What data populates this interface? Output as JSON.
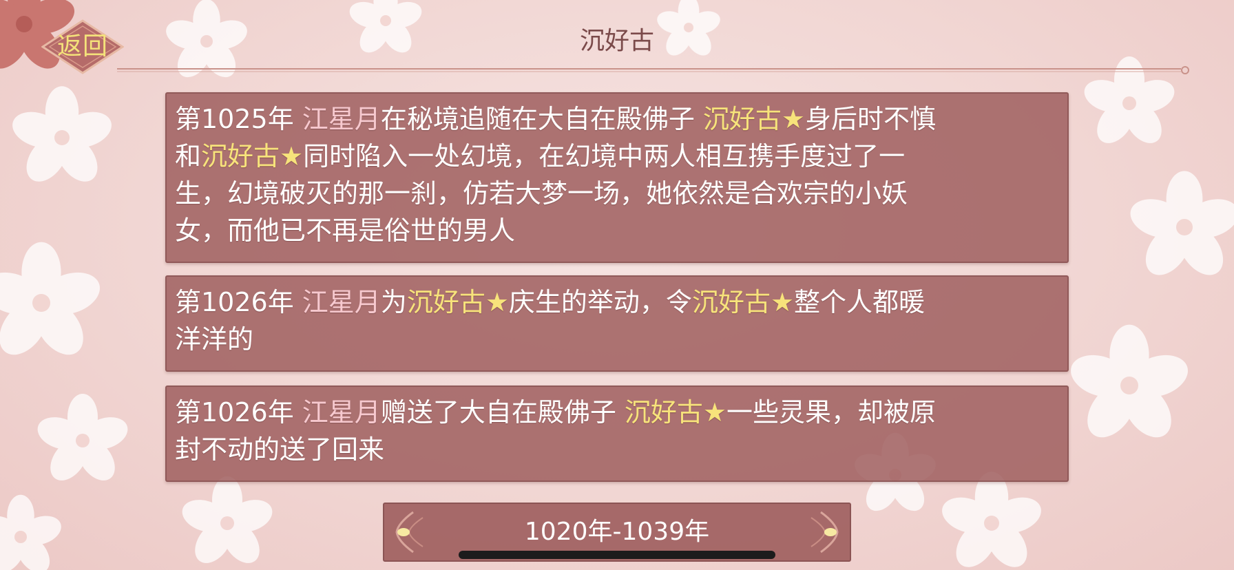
{
  "header": {
    "back_label": "返回",
    "title": "沉好古"
  },
  "events": [
    {
      "segments": [
        {
          "text": "第1025年 ",
          "style": "plain"
        },
        {
          "text": "江星月",
          "style": "pink"
        },
        {
          "text": "在秘境追随在大自在殿佛子 ",
          "style": "plain"
        },
        {
          "text": "沉好古",
          "style": "gold"
        },
        {
          "text": "★",
          "style": "star"
        },
        {
          "text": "身后时不慎",
          "style": "plain"
        },
        {
          "text": "\n",
          "style": "break"
        },
        {
          "text": "和",
          "style": "plain"
        },
        {
          "text": "沉好古",
          "style": "gold"
        },
        {
          "text": "★",
          "style": "star"
        },
        {
          "text": "同时陷入一处幻境，在幻境中两人相互携手度过了一",
          "style": "plain"
        },
        {
          "text": "\n",
          "style": "break"
        },
        {
          "text": "生，幻境破灭的那一刹，仿若大梦一场，她依然是合欢宗的小妖",
          "style": "plain"
        },
        {
          "text": "\n",
          "style": "break"
        },
        {
          "text": "女，而他已不再是俗世的男人",
          "style": "plain"
        }
      ]
    },
    {
      "segments": [
        {
          "text": "第1026年 ",
          "style": "plain"
        },
        {
          "text": "江星月",
          "style": "pink"
        },
        {
          "text": "为",
          "style": "plain"
        },
        {
          "text": "沉好古",
          "style": "gold"
        },
        {
          "text": "★",
          "style": "star"
        },
        {
          "text": "庆生的举动，令",
          "style": "plain"
        },
        {
          "text": "沉好古",
          "style": "gold"
        },
        {
          "text": "★",
          "style": "star"
        },
        {
          "text": "整个人都暖",
          "style": "plain"
        },
        {
          "text": "\n",
          "style": "break"
        },
        {
          "text": "洋洋的",
          "style": "plain"
        }
      ]
    },
    {
      "segments": [
        {
          "text": "第1026年 ",
          "style": "plain"
        },
        {
          "text": "江星月",
          "style": "pink"
        },
        {
          "text": "赠送了大自在殿佛子 ",
          "style": "plain"
        },
        {
          "text": "沉好古",
          "style": "gold"
        },
        {
          "text": "★",
          "style": "star"
        },
        {
          "text": "一些灵果，却被原",
          "style": "plain"
        },
        {
          "text": "\n",
          "style": "break"
        },
        {
          "text": "封不动的送了回来",
          "style": "plain"
        }
      ]
    }
  ],
  "period": {
    "label": "1020年-1039年"
  },
  "colors": {
    "name_pink": "#f7c9cf",
    "name_gold": "#f7e37b",
    "card_bg": "#a06060",
    "title_text": "#7b4a4a",
    "back_label": "#f4e27a"
  },
  "icons": {
    "back": "diamond-frame-icon",
    "prev": "ornate-arrow-left-icon",
    "next": "ornate-arrow-right-icon"
  }
}
